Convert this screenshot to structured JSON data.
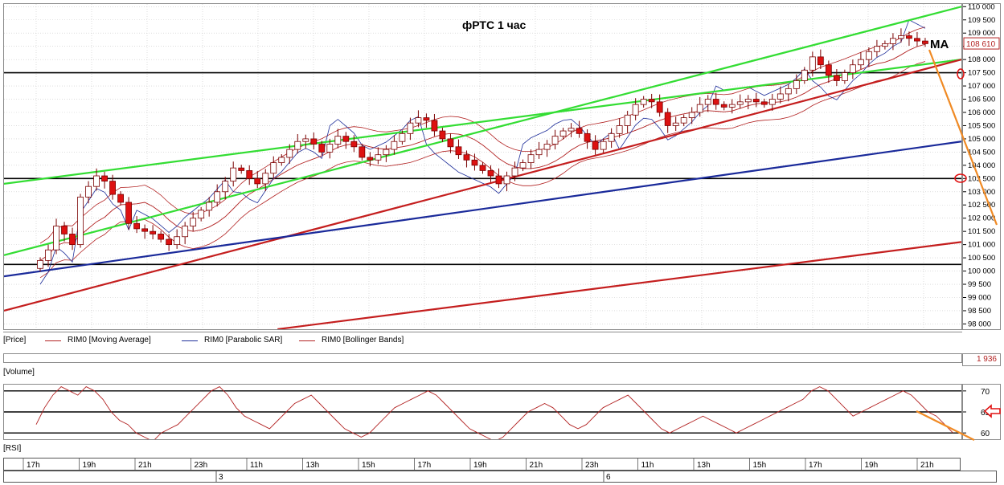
{
  "chart_data": {
    "type": "candlestick",
    "title": "фРТС   1 час",
    "annotation": "МА",
    "price_axis": {
      "ticks": [
        "110 000",
        "109 500",
        "109 000",
        "108 500",
        "108 000",
        "107 500",
        "107 000",
        "106 500",
        "106 000",
        "105 500",
        "105 000",
        "104 500",
        "104 000",
        "103 500",
        "103 000",
        "102 500",
        "102 000",
        "101 500",
        "101 000",
        "100 500",
        "100 000",
        "99 500",
        "99 000",
        "98 500",
        "98 000"
      ],
      "ylim": [
        97800,
        110100
      ],
      "last_price": "108 610"
    },
    "price_legend": {
      "panel": "[Price]",
      "items": [
        {
          "label": "RIM0 [Moving Average]",
          "color": "#b22222"
        },
        {
          "label": "RIM0 [Parabolic SAR]",
          "color": "#1f2f9a"
        },
        {
          "label": "RIM0 [Bollinger Bands]",
          "color": "#b22222"
        }
      ]
    },
    "horizontal_levels": [
      107500,
      103500,
      100250
    ],
    "candles_close": [
      100400,
      100800,
      101700,
      101400,
      101000,
      102800,
      103200,
      103600,
      103400,
      102900,
      102600,
      101800,
      101600,
      101500,
      101400,
      101200,
      101000,
      101300,
      101700,
      102000,
      102300,
      102600,
      103000,
      103400,
      103900,
      103800,
      103500,
      103300,
      103700,
      104100,
      104300,
      104600,
      104900,
      105000,
      104800,
      104500,
      104800,
      105100,
      104900,
      104700,
      104300,
      104200,
      104400,
      104600,
      104900,
      105200,
      105600,
      105800,
      105700,
      105300,
      105000,
      104700,
      104400,
      104200,
      104000,
      103800,
      103600,
      103300,
      103600,
      103900,
      104100,
      104400,
      104600,
      104800,
      105100,
      105300,
      105400,
      105200,
      104900,
      104600,
      104900,
      105200,
      105500,
      105900,
      106300,
      106500,
      106400,
      106000,
      105500,
      105600,
      105800,
      106000,
      106300,
      106500,
      106300,
      106200,
      106300,
      106400,
      106500,
      106400,
      106300,
      106500,
      106700,
      106900,
      107200,
      107600,
      108100,
      107800,
      107400,
      107200,
      107500,
      107800,
      108000,
      108300,
      108500,
      108600,
      108800,
      108900,
      108800,
      108700,
      108600
    ],
    "volume": {
      "label": "[Volume]",
      "last": "1 936"
    },
    "rsi": {
      "label": "[RSI]",
      "ticks": [
        "70",
        "65",
        "60"
      ],
      "levels": [
        70,
        65,
        60
      ],
      "ylim": [
        58.5,
        71.5
      ],
      "values": [
        62,
        66,
        69,
        71,
        70,
        69,
        71,
        70,
        68,
        65,
        63,
        62,
        60,
        59,
        58,
        60,
        61,
        62,
        64,
        66,
        68,
        70,
        71,
        69,
        66,
        64,
        63,
        62,
        61,
        63,
        65,
        67,
        68,
        69,
        67,
        65,
        63,
        61,
        60,
        59,
        60,
        62,
        64,
        66,
        67,
        68,
        69,
        70,
        69,
        67,
        65,
        63,
        61,
        60,
        59,
        58,
        59,
        61,
        63,
        65,
        66,
        67,
        66,
        64,
        62,
        61,
        62,
        64,
        66,
        67,
        68,
        69,
        67,
        65,
        63,
        61,
        60,
        61,
        62,
        63,
        64,
        63,
        62,
        61,
        60,
        61,
        62,
        63,
        64,
        65,
        66,
        67,
        68,
        70,
        71,
        70,
        68,
        66,
        64,
        65,
        66,
        67,
        68,
        69,
        70,
        69,
        67,
        65,
        64,
        62,
        60
      ]
    },
    "time_axis": {
      "labels": [
        "17h",
        "19h",
        "21h",
        "23h",
        "11h",
        "13h",
        "15h",
        "17h",
        "19h",
        "21h",
        "23h",
        "11h",
        "13h",
        "15h",
        "17h",
        "19h",
        "21h"
      ],
      "dates": [
        "3",
        "6"
      ]
    }
  }
}
